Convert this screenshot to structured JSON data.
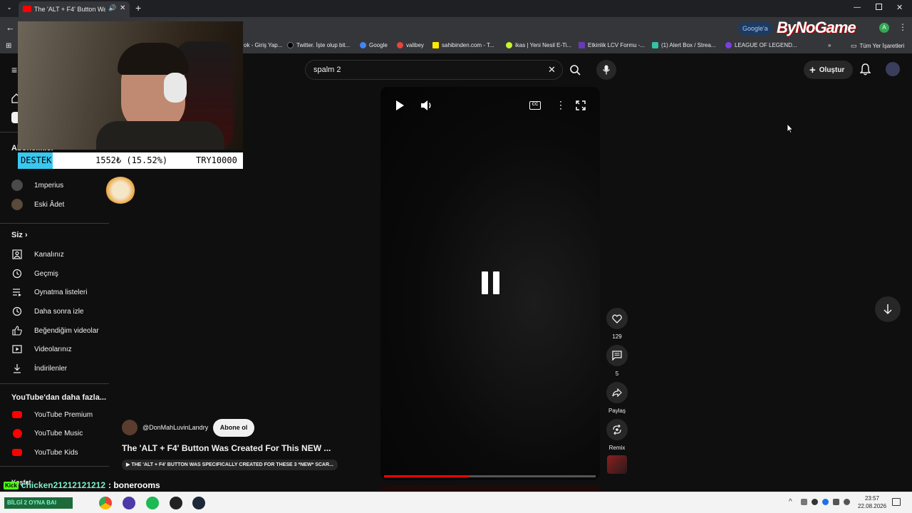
{
  "browser": {
    "tab_title": "The 'ALT + F4' Button Was C",
    "new_tab_symbol": "+",
    "bookmarks": [
      {
        "label": "ok - Giriş Yap...",
        "color": "#1877f2"
      },
      {
        "label": "Twitter. İşte olup bit...",
        "color": "#000000"
      },
      {
        "label": "Google",
        "color": "#4285f4"
      },
      {
        "label": "valibey",
        "color": "#e8453c"
      },
      {
        "label": "sahibinden.com - T...",
        "color": "#ffe800"
      },
      {
        "label": "ikas | Yeni Nesil E-Ti...",
        "color": "#c6f432"
      },
      {
        "label": "Etkinlik LCV Formu -...",
        "color": "#673ab7"
      },
      {
        "label": "(1) Alert Box / Strea...",
        "color": "#31c3a2"
      },
      {
        "label": "LEAGUE OF LEGEND...",
        "color": "#7b3fe4"
      }
    ],
    "all_bookmarks": "Tüm Yer İşaretleri",
    "google_chip": "Google'a",
    "brand_watermark": "ByNoGame",
    "profile_letter": "A"
  },
  "youtube": {
    "search": {
      "value": "spalm 2"
    },
    "create_label": "Oluştur",
    "sidebar": {
      "subscriptions_label": "Abonelikler",
      "subscriptions": [
        {
          "label": "1mperius"
        },
        {
          "label": "Eski Âdet"
        }
      ],
      "you_label": "Siz",
      "you_items": [
        {
          "label": "Kanalınız",
          "icon": "channel-icon"
        },
        {
          "label": "Geçmiş",
          "icon": "history-icon"
        },
        {
          "label": "Oynatma listeleri",
          "icon": "playlist-icon"
        },
        {
          "label": "Daha sonra izle",
          "icon": "clock-icon"
        },
        {
          "label": "Beğendiğim videolar",
          "icon": "thumb-up-icon"
        },
        {
          "label": "Videolarınız",
          "icon": "video-icon"
        },
        {
          "label": "İndirilenler",
          "icon": "download-icon"
        }
      ],
      "more_label": "YouTube'dan daha fazla...",
      "more_items": [
        {
          "label": "YouTube Premium",
          "color": "#ff0000"
        },
        {
          "label": "YouTube Music",
          "color": "#ff0000"
        },
        {
          "label": "YouTube Kids",
          "color": "#ff0000"
        }
      ],
      "cut_label": "Keşfet"
    },
    "short": {
      "channel": "@DonMahLuvinLandry",
      "subscribe_label": "Abone ol",
      "title": "The 'ALT + F4' Button Was Created For This NEW ...",
      "subtitle": "▶ THE 'ALT + F4' BUTTON WAS SPECIFICALLY CREATED FOR THESE 3 *NEW* SCAR...",
      "progress": 0.4,
      "actions": {
        "like_count": "129",
        "comment_count": "5",
        "share_label": "Paylaş",
        "remix_label": "Remix"
      }
    }
  },
  "stream_overlay": {
    "donation_label": "DESTEK",
    "donation_amount": "1552₺ (15.52%)",
    "donation_goal": "TRY10000",
    "chat_user": "chicken21212121212",
    "chat_message": ": bonerooms",
    "chat_prefix": "Kick"
  },
  "taskbar": {
    "time": "23:57",
    "date": "22.08.2026",
    "pinned_text": "BİLGİ 2 OYNA BAI"
  }
}
